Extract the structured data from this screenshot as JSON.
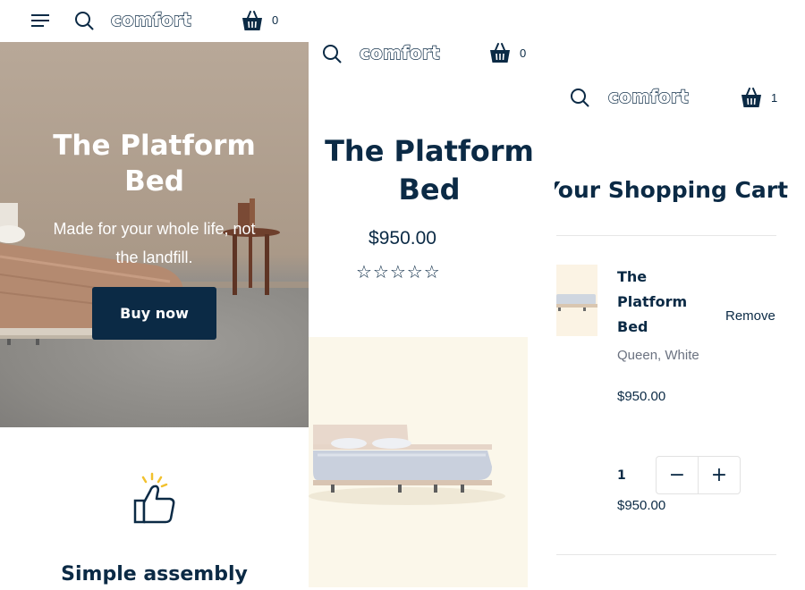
{
  "brand": {
    "logo": "comfort"
  },
  "screens": [
    {
      "header": {
        "cart_count": "0"
      },
      "hero": {
        "title": "The Platform\nBed",
        "subtitle": "Made for your whole life, not\nthe landfill.",
        "cta_label": "Buy now"
      },
      "feature": {
        "title": "Simple assembly"
      }
    },
    {
      "header": {
        "cart_count": "0"
      },
      "product": {
        "title": "The Platform\nBed",
        "price": "$950.00",
        "rating_stars": "☆☆☆☆☆"
      }
    },
    {
      "header": {
        "cart_count": "1"
      },
      "cart": {
        "title": "Your Shopping Cart",
        "item": {
          "name": "The\nPlatform\nBed",
          "remove_label": "Remove",
          "variant": "Queen, White",
          "price": "$950.00",
          "quantity": "1",
          "decrement_label": "−",
          "increment_label": "+",
          "line_total": "$950.00"
        }
      }
    }
  ],
  "icons": {
    "menu": "hamburger-menu-icon",
    "search": "search-icon",
    "basket": "shopping-basket-icon",
    "thumbs_up": "thumbs-up-icon"
  },
  "colors": {
    "navy": "#0b2a45",
    "cream": "#fbf7ea",
    "muted_text": "#6b7280"
  }
}
